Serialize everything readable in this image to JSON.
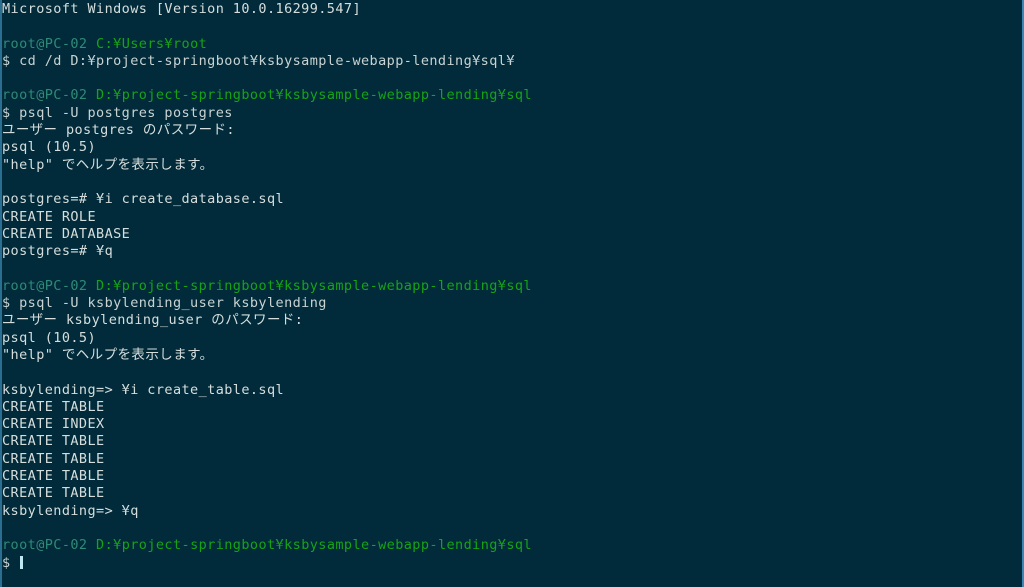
{
  "window": {
    "title": "MINGW64 / Git Bash terminal",
    "background_color": "#012b3a",
    "foreground_color": "#d6dedd",
    "host_color": "#2f8a77",
    "path_color": "#17a317",
    "cursor_color": "#bfe8f3",
    "edge_strip_color": "#3a86b5"
  },
  "terminal": {
    "lines": [
      {
        "id": "banner",
        "segments": [
          {
            "role": "default",
            "text": "Microsoft Windows [Version 10.0.16299.547]"
          }
        ]
      },
      {
        "id": "blank-1",
        "segments": []
      },
      {
        "id": "prompt-1",
        "segments": [
          {
            "role": "host",
            "text": "root@PC-02"
          },
          {
            "role": "default",
            "text": " "
          },
          {
            "role": "path",
            "text": "C:¥Users¥root"
          }
        ]
      },
      {
        "id": "command-1",
        "segments": [
          {
            "role": "prompt",
            "text": "$ cd /d D:¥project-springboot¥ksbysample-webapp-lending¥sql¥"
          }
        ]
      },
      {
        "id": "blank-2",
        "segments": []
      },
      {
        "id": "prompt-2",
        "segments": [
          {
            "role": "host",
            "text": "root@PC-02"
          },
          {
            "role": "default",
            "text": " "
          },
          {
            "role": "path",
            "text": "D:¥project-springboot¥ksbysample-webapp-lending¥sql"
          }
        ]
      },
      {
        "id": "command-2",
        "segments": [
          {
            "role": "prompt",
            "text": "$ psql -U postgres postgres"
          }
        ]
      },
      {
        "id": "output-1",
        "segments": [
          {
            "role": "default",
            "text": "ユーザー postgres のパスワード:"
          }
        ]
      },
      {
        "id": "output-2",
        "segments": [
          {
            "role": "default",
            "text": "psql (10.5)"
          }
        ]
      },
      {
        "id": "output-3",
        "segments": [
          {
            "role": "default",
            "text": "\"help\" でヘルプを表示します。"
          }
        ]
      },
      {
        "id": "blank-3",
        "segments": []
      },
      {
        "id": "psql-command-1",
        "segments": [
          {
            "role": "default",
            "text": "postgres=# ¥i create_database.sql"
          }
        ]
      },
      {
        "id": "psql-output-1",
        "segments": [
          {
            "role": "default",
            "text": "CREATE ROLE"
          }
        ]
      },
      {
        "id": "psql-output-2",
        "segments": [
          {
            "role": "default",
            "text": "CREATE DATABASE"
          }
        ]
      },
      {
        "id": "psql-command-2",
        "segments": [
          {
            "role": "default",
            "text": "postgres=# ¥q"
          }
        ]
      },
      {
        "id": "blank-4",
        "segments": []
      },
      {
        "id": "prompt-3",
        "segments": [
          {
            "role": "host",
            "text": "root@PC-02"
          },
          {
            "role": "default",
            "text": " "
          },
          {
            "role": "path",
            "text": "D:¥project-springboot¥ksbysample-webapp-lending¥sql"
          }
        ]
      },
      {
        "id": "command-3",
        "segments": [
          {
            "role": "prompt",
            "text": "$ psql -U ksbylending_user ksbylending"
          }
        ]
      },
      {
        "id": "output-4",
        "segments": [
          {
            "role": "default",
            "text": "ユーザー ksbylending_user のパスワード:"
          }
        ]
      },
      {
        "id": "output-5",
        "segments": [
          {
            "role": "default",
            "text": "psql (10.5)"
          }
        ]
      },
      {
        "id": "output-6",
        "segments": [
          {
            "role": "default",
            "text": "\"help\" でヘルプを表示します。"
          }
        ]
      },
      {
        "id": "blank-5",
        "segments": []
      },
      {
        "id": "psql-command-3",
        "segments": [
          {
            "role": "default",
            "text": "ksbylending=> ¥i create_table.sql"
          }
        ]
      },
      {
        "id": "psql-output-3",
        "segments": [
          {
            "role": "default",
            "text": "CREATE TABLE"
          }
        ]
      },
      {
        "id": "psql-output-4",
        "segments": [
          {
            "role": "default",
            "text": "CREATE INDEX"
          }
        ]
      },
      {
        "id": "psql-output-5",
        "segments": [
          {
            "role": "default",
            "text": "CREATE TABLE"
          }
        ]
      },
      {
        "id": "psql-output-6",
        "segments": [
          {
            "role": "default",
            "text": "CREATE TABLE"
          }
        ]
      },
      {
        "id": "psql-output-7",
        "segments": [
          {
            "role": "default",
            "text": "CREATE TABLE"
          }
        ]
      },
      {
        "id": "psql-output-8",
        "segments": [
          {
            "role": "default",
            "text": "CREATE TABLE"
          }
        ]
      },
      {
        "id": "psql-command-4",
        "segments": [
          {
            "role": "default",
            "text": "ksbylending=> ¥q"
          }
        ]
      },
      {
        "id": "blank-6",
        "segments": []
      },
      {
        "id": "prompt-4",
        "segments": [
          {
            "role": "host",
            "text": "root@PC-02"
          },
          {
            "role": "default",
            "text": " "
          },
          {
            "role": "path",
            "text": "D:¥project-springboot¥ksbysample-webapp-lending¥sql"
          }
        ]
      },
      {
        "id": "command-4",
        "segments": [
          {
            "role": "prompt",
            "text": "$ "
          }
        ],
        "cursor": true
      }
    ]
  }
}
